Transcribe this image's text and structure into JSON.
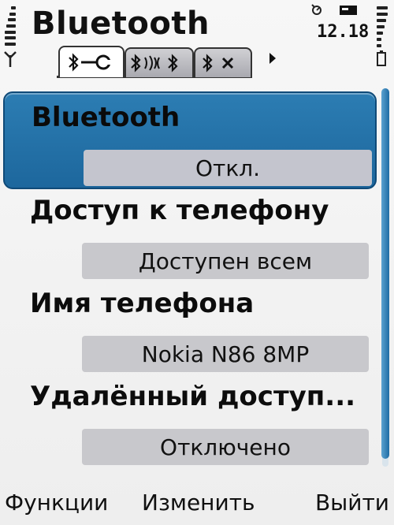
{
  "status_bar": {
    "title": "Bluetooth",
    "time": "12.18",
    "icons": {
      "signal": "signal-strength-icon",
      "antenna": "antenna-icon",
      "alarm": "alarm-clock-icon",
      "mail": "new-message-icon",
      "battery": "battery-icon"
    }
  },
  "tabs": [
    {
      "icon": "bluetooth-settings-icon",
      "active": true
    },
    {
      "icon": "bluetooth-paired-devices-icon",
      "active": false
    },
    {
      "icon": "bluetooth-blocked-devices-icon",
      "active": false
    }
  ],
  "settings": [
    {
      "label": "Bluetooth",
      "value": "Откл.",
      "selected": true
    },
    {
      "label": "Доступ к телефону",
      "value": "Доступен всем",
      "selected": false
    },
    {
      "label": "Имя телефона",
      "value": "Nokia N86 8MP",
      "selected": false
    },
    {
      "label": "Удалённый доступ...",
      "value": "Отключено",
      "selected": false
    }
  ],
  "softkeys": {
    "left": "Функции",
    "middle": "Изменить",
    "right": "Выйти"
  },
  "colors": {
    "highlight": "#1d679d",
    "value_box": "#c8c8cc",
    "scrollbar": "#2a77ad"
  }
}
